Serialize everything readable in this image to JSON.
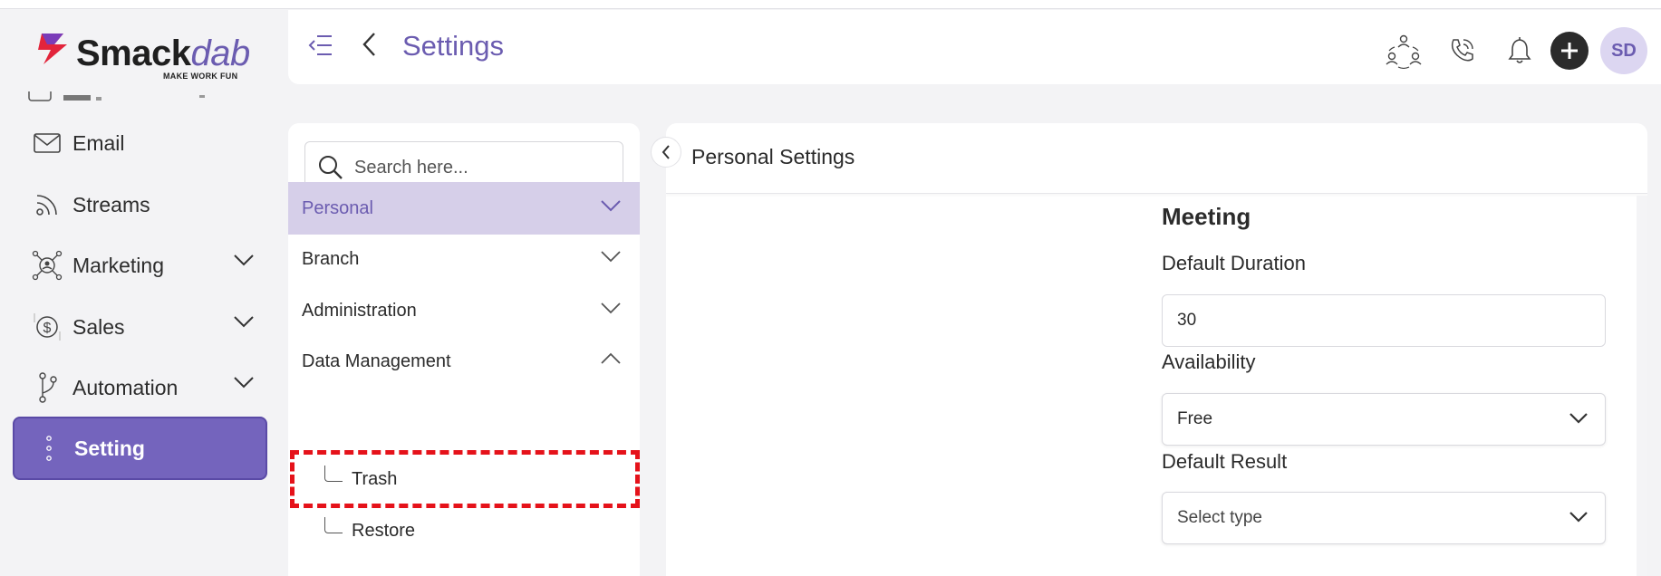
{
  "app": {
    "logo_word_a": "Smack",
    "logo_word_b": "dab",
    "logo_tagline": "MAKE WORK FUN"
  },
  "header": {
    "title": "Settings",
    "avatar_initials": "SD",
    "icons": [
      "team-icon",
      "phone-icon",
      "bell-icon",
      "plus-icon"
    ]
  },
  "sidebar": {
    "items": [
      {
        "label": "Email",
        "icon": "mail-icon"
      },
      {
        "label": "Streams",
        "icon": "rss-icon"
      },
      {
        "label": "Marketing",
        "icon": "network-icon",
        "expandable": true
      },
      {
        "label": "Sales",
        "icon": "dollar-icon",
        "expandable": true
      },
      {
        "label": "Automation",
        "icon": "branch-icon",
        "expandable": true
      },
      {
        "label": "Setting",
        "icon": "dots-icon",
        "active": true
      }
    ]
  },
  "settings_nav": {
    "search_placeholder": "Search here...",
    "groups": [
      {
        "label": "Personal",
        "selected": true,
        "expanded": false
      },
      {
        "label": "Branch",
        "expanded": false
      },
      {
        "label": "Administration",
        "expanded": false
      },
      {
        "label": "Data Management",
        "expanded": true
      }
    ],
    "sub_items": [
      {
        "label": "Trash",
        "highlighted": true
      },
      {
        "label": "Restore"
      }
    ]
  },
  "content": {
    "title": "Personal Settings",
    "section_title": "Meeting",
    "fields": {
      "default_duration_label": "Default Duration",
      "default_duration_value": "30",
      "availability_label": "Availability",
      "availability_value": "Free",
      "default_result_label": "Default Result",
      "default_result_placeholder": "Select type"
    }
  },
  "colors": {
    "accent": "#6b5cb0",
    "active_nav": "#7464bd",
    "selected_group": "#d6cfe9",
    "highlight_box": "#e5121a"
  }
}
